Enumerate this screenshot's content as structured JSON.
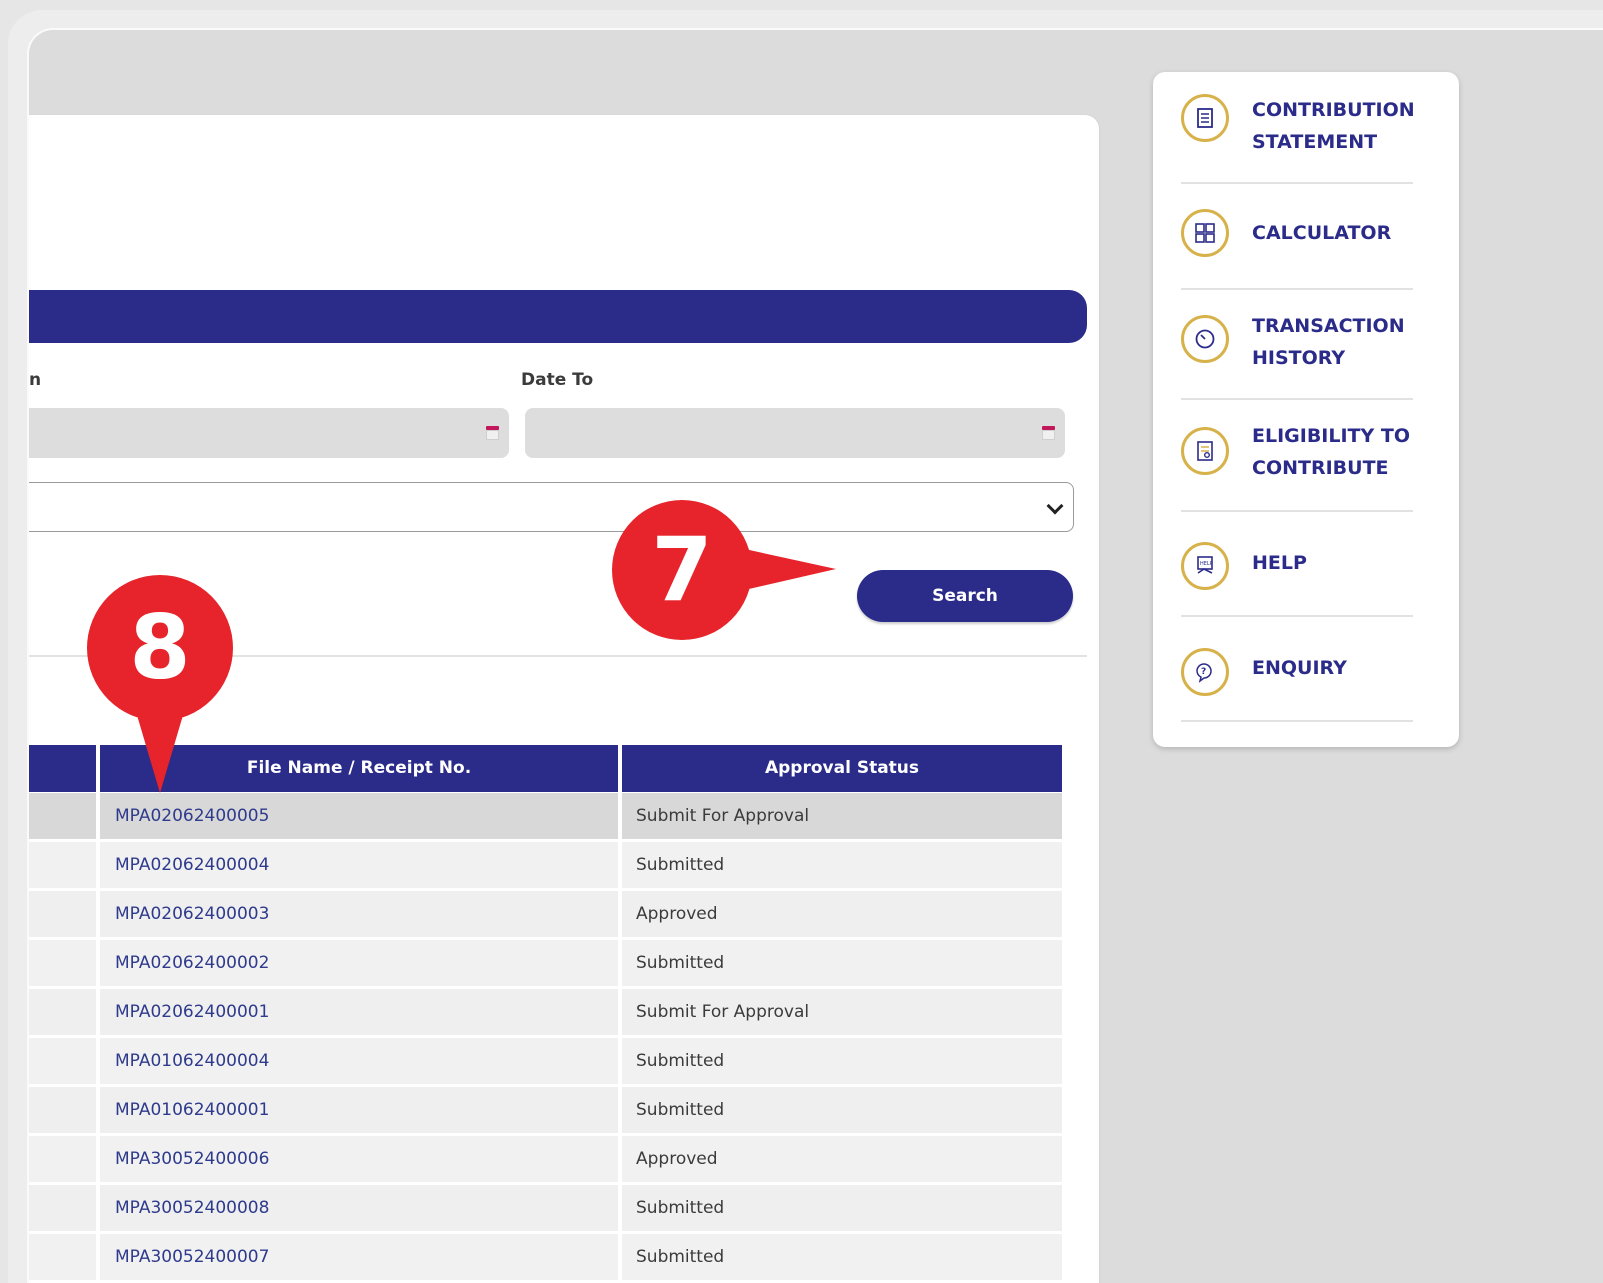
{
  "filters": {
    "date_from_label_fragment": "n",
    "date_to_label": "Date To",
    "search_label": "Search"
  },
  "table": {
    "headers": [
      "File Name / Receipt No.",
      "Approval Status"
    ],
    "rows": [
      {
        "receipt": "MPA02062400005",
        "status": "Submit For Approval"
      },
      {
        "receipt": "MPA02062400004",
        "status": "Submitted"
      },
      {
        "receipt": "MPA02062400003",
        "status": "Approved"
      },
      {
        "receipt": "MPA02062400002",
        "status": "Submitted"
      },
      {
        "receipt": "MPA02062400001",
        "status": "Submit For Approval"
      },
      {
        "receipt": "MPA01062400004",
        "status": "Submitted"
      },
      {
        "receipt": "MPA01062400001",
        "status": "Submitted"
      },
      {
        "receipt": "MPA30052400006",
        "status": "Approved"
      },
      {
        "receipt": "MPA30052400008",
        "status": "Submitted"
      },
      {
        "receipt": "MPA30052400007",
        "status": "Submitted"
      }
    ]
  },
  "sidebar": {
    "items": [
      {
        "label": "CONTRIBUTION\nSTATEMENT",
        "icon": "document-icon"
      },
      {
        "label": "CALCULATOR",
        "icon": "calculator-icon"
      },
      {
        "label": "TRANSACTION\nHISTORY",
        "icon": "clock-icon"
      },
      {
        "label": "ELIGIBILITY TO\nCONTRIBUTE",
        "icon": "checklist-icon"
      },
      {
        "label": "HELP",
        "icon": "help-icon"
      },
      {
        "label": "ENQUIRY",
        "icon": "enquiry-icon"
      }
    ]
  },
  "annotations": {
    "marker_7": "7",
    "marker_8": "8"
  },
  "colors": {
    "primary": "#2b2b8a",
    "accent": "#d7b24a",
    "marker": "#e7242b"
  }
}
